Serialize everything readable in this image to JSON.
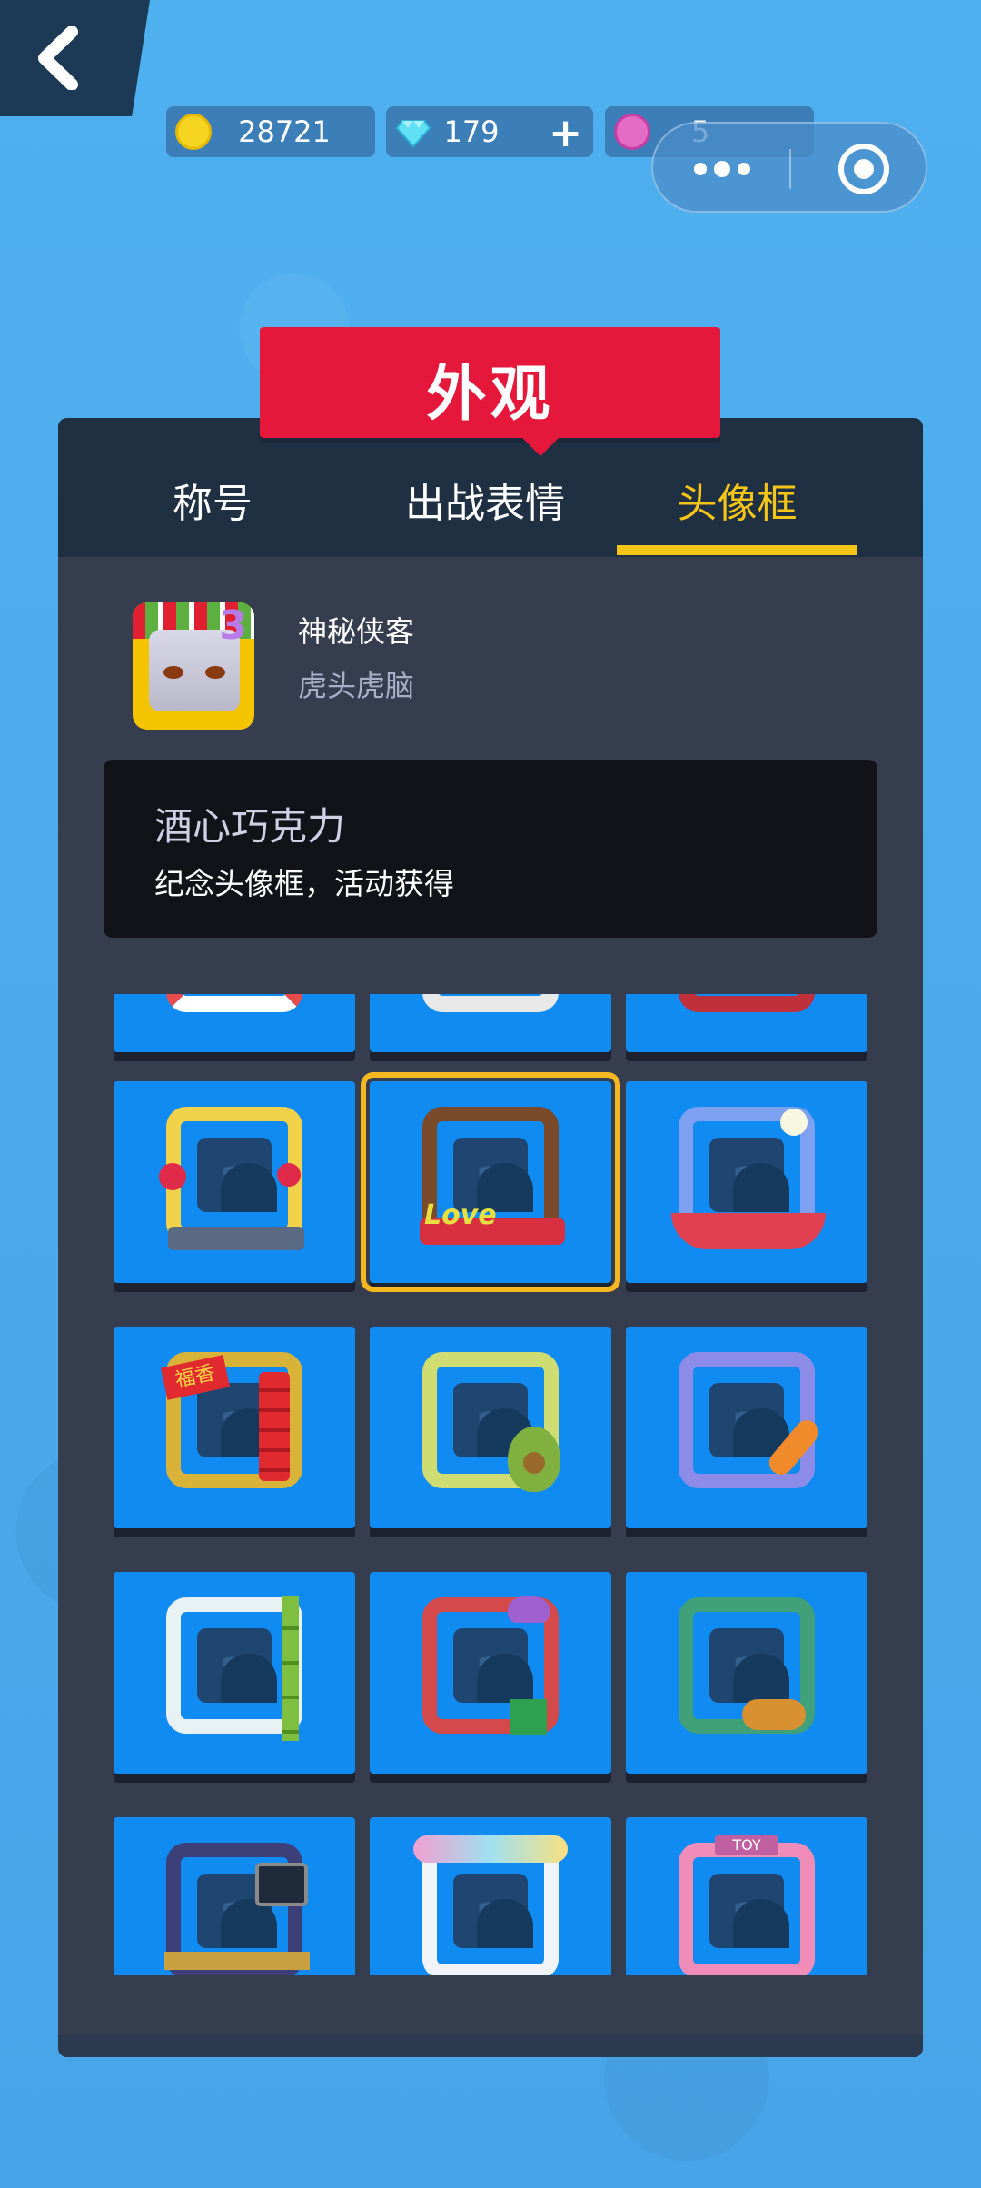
{
  "header": {
    "currency": {
      "coins": "28721",
      "gems": "179",
      "lotus": "5"
    },
    "plus_label": "+"
  },
  "banner": {
    "title": "外观"
  },
  "tabs": [
    {
      "label": "称号",
      "active": false
    },
    {
      "label": "出战表情",
      "active": false
    },
    {
      "label": "头像框",
      "active": true
    }
  ],
  "profile": {
    "nickname": "神秘侠客",
    "title": "虎头虎脑"
  },
  "selected_item": {
    "name": "酒心巧克力",
    "description": "纪念头像框，活动获得"
  },
  "grid": {
    "unknown_glyph": "?",
    "items": [
      {
        "name": "partial-frame-1",
        "color": "#e84b4b"
      },
      {
        "name": "partial-frame-2",
        "color": "#e8e8e8"
      },
      {
        "name": "partial-frame-3",
        "color": "#c0303a"
      },
      {
        "name": "hearts-frame",
        "color": "#f2d24a"
      },
      {
        "name": "chocolate-love-frame",
        "color": "#7a4a2a",
        "selected": true,
        "label": "Love"
      },
      {
        "name": "moon-rabbit-frame",
        "color": "#7ea0f0"
      },
      {
        "name": "firecracker-frame",
        "color": "#d9b238",
        "label": "福香"
      },
      {
        "name": "avocado-frame",
        "color": "#cfdc72"
      },
      {
        "name": "carrot-frame",
        "color": "#8c8ce8"
      },
      {
        "name": "bamboo-frame",
        "color": "#e8f2f5"
      },
      {
        "name": "jester-frame",
        "color": "#d44a4a"
      },
      {
        "name": "autumn-frame",
        "color": "#3fa07a"
      },
      {
        "name": "monitor-frame",
        "color": "#3c3f78"
      },
      {
        "name": "rainbow-cloud-frame",
        "color": "#f0f4f8"
      },
      {
        "name": "toy-frame",
        "color": "#f08cb8",
        "label": "TOY"
      }
    ]
  }
}
